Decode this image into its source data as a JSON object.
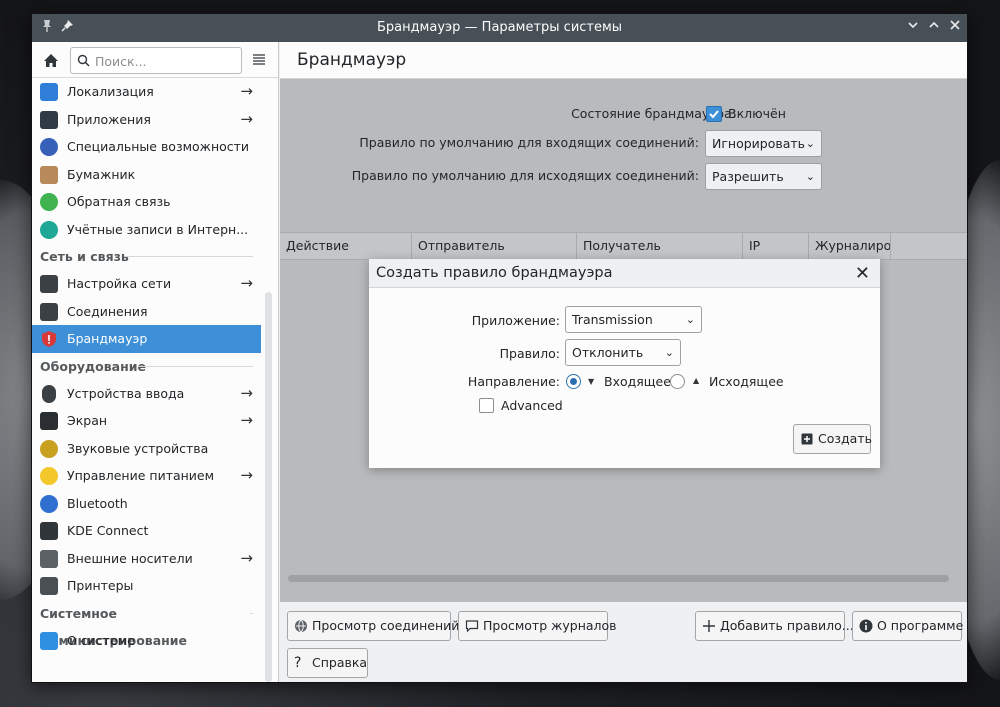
{
  "window": {
    "title": "Брандмауэр — Параметры системы"
  },
  "search": {
    "placeholder": "Поиск..."
  },
  "sidebar": {
    "items_top": [
      {
        "label": "Локализация",
        "arrow": true,
        "icon": "localization-icon",
        "color": "#2f7fd8"
      },
      {
        "label": "Приложения",
        "arrow": true,
        "icon": "applications-icon",
        "color": "#2f3a44"
      },
      {
        "label": "Специальные возможности",
        "arrow": false,
        "icon": "accessibility-icon",
        "color": "#3760b8"
      },
      {
        "label": "Бумажник",
        "arrow": false,
        "icon": "wallet-icon",
        "color": "#b8895a"
      },
      {
        "label": "Обратная связь",
        "arrow": false,
        "icon": "feedback-icon",
        "color": "#3fb34f"
      },
      {
        "label": "Учётные записи в Интерн...",
        "arrow": false,
        "icon": "online-accounts-icon",
        "color": "#1fa896"
      }
    ],
    "section_network": "Сеть и связь",
    "items_network": [
      {
        "label": "Настройка сети",
        "arrow": true,
        "icon": "network-icon",
        "color": "#3b4045"
      },
      {
        "label": "Соединения",
        "arrow": false,
        "icon": "connections-icon",
        "color": "#3b4045"
      },
      {
        "label": "Брандмауэр",
        "arrow": false,
        "icon": "firewall-icon",
        "color": "#d83a3a"
      }
    ],
    "section_hardware": "Оборудование",
    "items_hardware": [
      {
        "label": "Устройства ввода",
        "arrow": true,
        "icon": "mouse-icon",
        "color": "#3b4045"
      },
      {
        "label": "Экран",
        "arrow": true,
        "icon": "display-icon",
        "color": "#2a2e32"
      },
      {
        "label": "Звуковые устройства",
        "arrow": false,
        "icon": "speaker-icon",
        "color": "#caa020"
      },
      {
        "label": "Управление питанием",
        "arrow": true,
        "icon": "power-icon",
        "color": "#f2c82a"
      },
      {
        "label": "Bluetooth",
        "arrow": false,
        "icon": "bluetooth-icon",
        "color": "#2f6fd0"
      },
      {
        "label": "KDE Connect",
        "arrow": false,
        "icon": "kdeconnect-icon",
        "color": "#31363b"
      },
      {
        "label": "Внешние носители",
        "arrow": true,
        "icon": "removable-media-icon",
        "color": "#5c6166"
      },
      {
        "label": "Принтеры",
        "arrow": false,
        "icon": "printer-icon",
        "color": "#4a4f54"
      }
    ],
    "section_admin": "Системное администрирование",
    "items_admin": [
      {
        "label": "О системе",
        "arrow": false,
        "icon": "info-icon",
        "color": "#2f8fe0"
      }
    ]
  },
  "page": {
    "title": "Брандмауэр",
    "status_label": "Состояние брандмауэра:",
    "status_value": "Включён",
    "incoming_label": "Правило по умолчанию для входящих соединений:",
    "incoming_value": "Игнорировать",
    "outgoing_label": "Правило по умолчанию для исходящих соединений:",
    "outgoing_value": "Разрешить",
    "columns": [
      "Действие",
      "Отправитель",
      "Получатель",
      "IP",
      "Журналиров"
    ]
  },
  "dialog": {
    "title": "Создать правило брандмауэра",
    "app_label": "Приложение:",
    "app_value": "Transmission",
    "rule_label": "Правило:",
    "rule_value": "Отклонить",
    "direction_label": "Направление:",
    "incoming": "Входящее",
    "outgoing": "Исходящее",
    "advanced": "Advanced",
    "create": "Создать"
  },
  "buttons": {
    "view_connections": "Просмотр соединений",
    "view_logs": "Просмотр журналов",
    "add_rule": "Добавить правило...",
    "about": "О программе",
    "help": "Справка"
  }
}
